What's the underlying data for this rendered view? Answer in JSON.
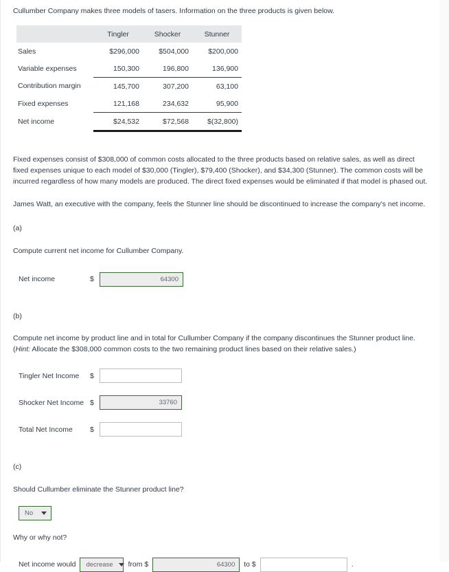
{
  "intro": "Cullumber Company makes three models of tasers. Information on the three products is given below.",
  "table": {
    "columns": [
      "",
      "Tingler",
      "Shocker",
      "Stunner"
    ],
    "rows": [
      {
        "label": "Sales",
        "values": [
          "$296,000",
          "$504,000",
          "$200,000"
        ]
      },
      {
        "label": "Variable expenses",
        "values": [
          "150,300",
          "196,800",
          "136,900"
        ]
      },
      {
        "label": "Contribution margin",
        "values": [
          "145,700",
          "307,200",
          "63,100"
        ]
      },
      {
        "label": "Fixed expenses",
        "values": [
          "121,168",
          "234,632",
          "95,900"
        ]
      },
      {
        "label": "Net income",
        "values": [
          "$24,532",
          "$72,568",
          "$(32,800)"
        ]
      }
    ]
  },
  "paragraphs": {
    "fixed_expenses": "Fixed expenses consist of $308,000 of common costs allocated to the three products based on relative sales, as well as direct fixed expenses unique to each model of $30,000 (Tingler), $79,400 (Shocker), and $34,300 (Stunner). The common costs will be incurred regardless of how many models are produced. The direct fixed expenses would be eliminated if that model is phased out.",
    "james_watt": "James Watt, an executive with the company, feels the Stunner line should be discontinued to increase the company's net income."
  },
  "section_a": {
    "letter": "(a)",
    "prompt": "Compute current net income for Cullumber Company.",
    "net_income_label": "Net income",
    "dollar": "$",
    "net_income_value": "64300"
  },
  "section_b": {
    "letter": "(b)",
    "prompt_part1": "Compute net income by product line and in total for Cullumber Company if the company discontinues the Stunner product line. (",
    "prompt_hint": "Hint:",
    "prompt_part2": " Allocate the $308,000 common costs to the two remaining product lines based on their relative sales.)",
    "rows": [
      {
        "label": "Tingler Net Income",
        "dollar": "$",
        "value": ""
      },
      {
        "label": "Shocker Net Income",
        "dollar": "$",
        "value": "33760"
      },
      {
        "label": "Total Net Income",
        "dollar": "$",
        "value": ""
      }
    ]
  },
  "section_c": {
    "letter": "(c)",
    "prompt": "Should Cullumber eliminate the Stunner product line?",
    "eliminate_select": "No",
    "why_label": "Why or why not?",
    "net_income_would": "Net income would",
    "direction_select": "decrease",
    "from_label": "from $",
    "from_value": "64300",
    "to_label": "to $",
    "to_value": "",
    "period": "."
  }
}
